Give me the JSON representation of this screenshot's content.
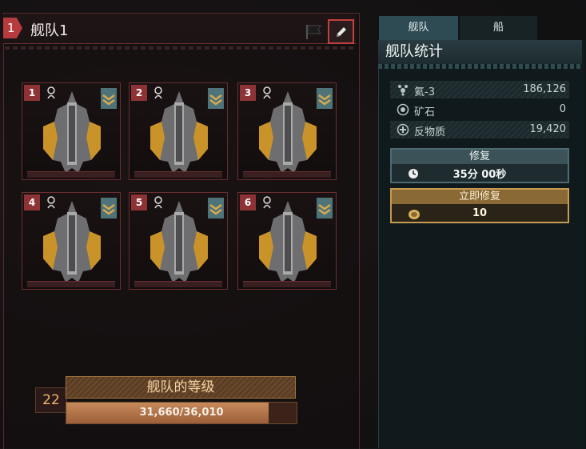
{
  "fleet": {
    "number": "1",
    "title": "舰队1",
    "slots": [
      {
        "num": "1"
      },
      {
        "num": "2"
      },
      {
        "num": "3"
      },
      {
        "num": "4"
      },
      {
        "num": "5"
      },
      {
        "num": "6"
      }
    ],
    "level": {
      "value": "22",
      "title": "舰队的等级",
      "progress_text": "31,660/36,010",
      "progress_fraction": 0.879
    }
  },
  "tabs": {
    "fleet": "舰队",
    "ship": "船"
  },
  "stats": {
    "title": "舰队统计",
    "resources": [
      {
        "icon": "helium-icon",
        "label": "氦-3",
        "value": "186,126"
      },
      {
        "icon": "ore-icon",
        "label": "矿石",
        "value": "0"
      },
      {
        "icon": "antimatter-icon",
        "label": "反物质",
        "value": "19,420"
      }
    ],
    "repair": {
      "label": "修复",
      "time": "35分 00秒"
    },
    "instant_repair": {
      "label": "立即修复",
      "cost": "10"
    }
  },
  "colors": {
    "fleet_accent": "#b73a3d",
    "gold": "#c69a50",
    "teal": "#2e4a52"
  }
}
